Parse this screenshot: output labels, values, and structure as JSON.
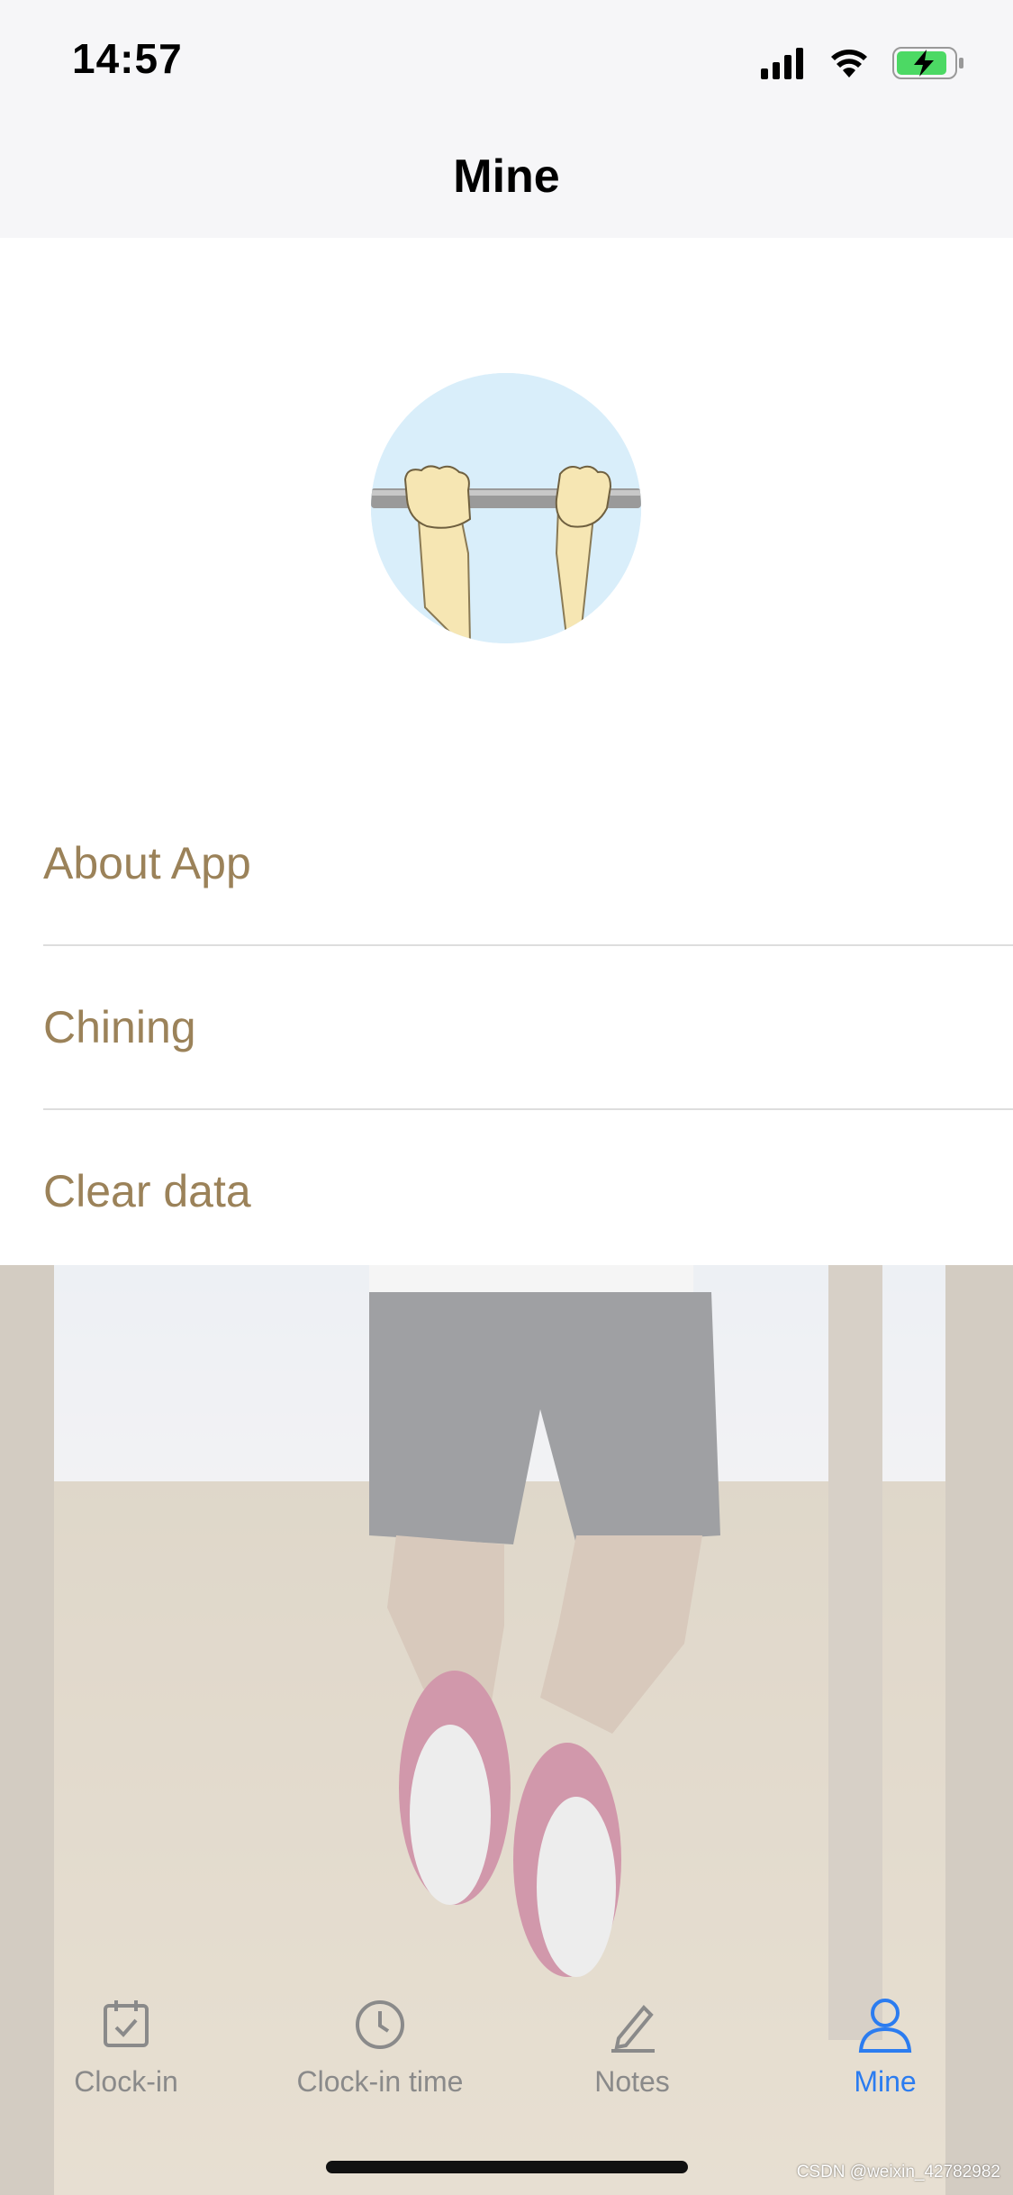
{
  "status_bar": {
    "time": "14:57",
    "icons": [
      "signal-icon",
      "wifi-icon",
      "battery-charging-icon"
    ]
  },
  "nav": {
    "title": "Mine"
  },
  "avatar": {
    "description_icon": "pull-up-bar-avatar"
  },
  "menu": {
    "items": [
      {
        "label": "About App"
      },
      {
        "label": "Chining"
      },
      {
        "label": "Clear data"
      }
    ]
  },
  "tabbar": {
    "tabs": [
      {
        "label": "Clock-in",
        "icon": "calendar-check-icon"
      },
      {
        "label": "Clock-in time",
        "icon": "clock-icon"
      },
      {
        "label": "Notes",
        "icon": "pen-icon"
      },
      {
        "label": "Mine",
        "icon": "person-icon",
        "active": true
      }
    ]
  },
  "watermark": "CSDN @weixin_42782982",
  "colors": {
    "menu_text": "#9b8259",
    "active_tab": "#2b7cf0",
    "inactive_tab": "#8a8a8a",
    "nav_bg": "#f6f6f8"
  }
}
